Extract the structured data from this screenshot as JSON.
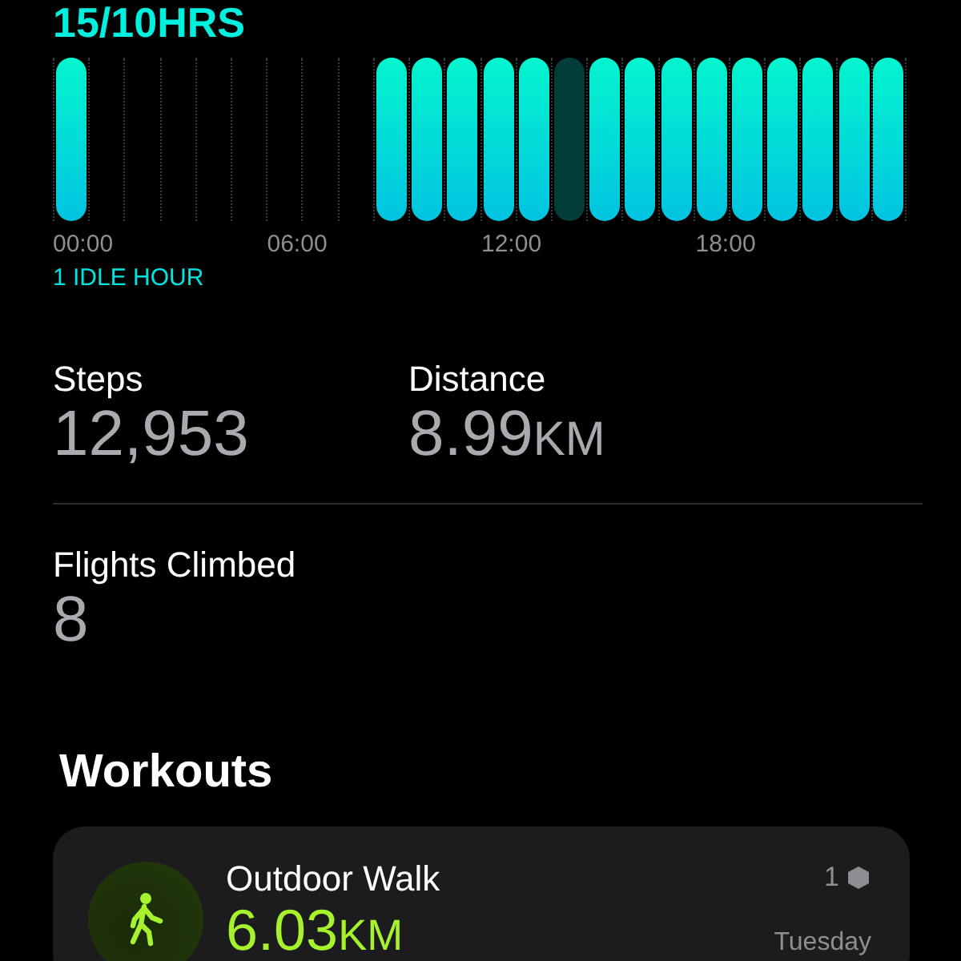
{
  "stand": {
    "heading": "15/10HRS",
    "hours": [
      {
        "kind": "stood"
      },
      {
        "kind": "none"
      },
      {
        "kind": "none"
      },
      {
        "kind": "none"
      },
      {
        "kind": "none"
      },
      {
        "kind": "none"
      },
      {
        "kind": "none"
      },
      {
        "kind": "none"
      },
      {
        "kind": "none"
      },
      {
        "kind": "stood"
      },
      {
        "kind": "stood"
      },
      {
        "kind": "stood"
      },
      {
        "kind": "stood"
      },
      {
        "kind": "stood"
      },
      {
        "kind": "idle"
      },
      {
        "kind": "stood"
      },
      {
        "kind": "stood"
      },
      {
        "kind": "stood"
      },
      {
        "kind": "stood"
      },
      {
        "kind": "stood"
      },
      {
        "kind": "stood"
      },
      {
        "kind": "stood"
      },
      {
        "kind": "stood"
      },
      {
        "kind": "stood"
      }
    ],
    "time_labels": [
      "00:00",
      "06:00",
      "12:00",
      "18:00"
    ],
    "idle_note": "1 IDLE HOUR"
  },
  "metrics": [
    {
      "label": "Steps",
      "value": "12,953"
    },
    {
      "label": "Distance",
      "value": "8.99",
      "unit": "KM"
    },
    {
      "label": "Flights Climbed",
      "value": "8"
    }
  ],
  "workouts": {
    "title": "Workouts",
    "items": [
      {
        "name": "Outdoor Walk",
        "value": "6.03",
        "unit": "KM",
        "count": "1",
        "day": "Tuesday"
      }
    ]
  }
}
